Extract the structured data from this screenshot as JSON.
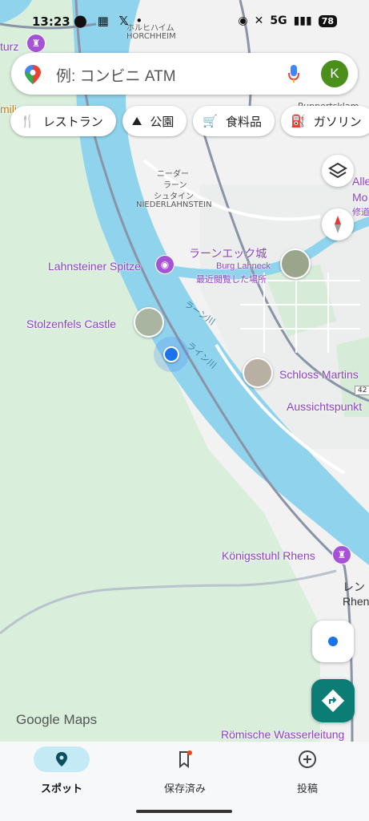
{
  "status_bar": {
    "time": "13:23",
    "network": "5G",
    "battery": "78"
  },
  "search": {
    "placeholder": "例: コンビニ ATM",
    "avatar_letter": "K"
  },
  "chips": [
    {
      "icon": "restaurant-icon",
      "label": "レストラン"
    },
    {
      "icon": "park-icon",
      "label": "公園"
    },
    {
      "icon": "grocery-icon",
      "label": "食料品"
    },
    {
      "icon": "gas-icon",
      "label": "ガソリン"
    }
  ],
  "map_labels": {
    "top_left_partial": "turz",
    "top_left_partial2": "mili",
    "horchheim_jp": "ホルヒハイム",
    "horchheim": "HORCHHEIM",
    "ruppertsklamm": "Ruppertsklam",
    "niederlahnstein_jp1": "ニーダー",
    "niederlahnstein_jp2": "ラーン",
    "niederlahnstein_jp3": "シュタイン",
    "niederlahnstein": "NIEDERLAHNSTEIN",
    "allerheiligen_partial": "Alle",
    "allerheiligen_partial2": "Mo",
    "allerheiligen_partial3": "修道",
    "lahnsteiner_spitze": "Lahnsteiner Spitze",
    "burg_lahneck_jp": "ラーンエック城",
    "burg_lahneck": "Burg Lahneck",
    "recently_viewed": "最近閲覧した場所",
    "lahn_river": "ラーン川",
    "rhine_river": "ライン川",
    "stolzenfels": "Stolzenfels Castle",
    "schloss_martinsburg": "Schloss Martins",
    "aussichtspunkt": "Aussichtspunkt",
    "route_42": "42",
    "koenigsstuhl": "Königsstuhl Rhens",
    "rhens_jp": "レン",
    "rhens": "Rhen",
    "roemische": "Römische Wasserleitung",
    "google_maps": "Google Maps"
  },
  "bottom_nav": [
    {
      "icon": "explore-pin-icon",
      "label": "スポット",
      "active": true
    },
    {
      "icon": "bookmark-icon",
      "label": "保存済み",
      "active": false
    },
    {
      "icon": "add-circle-icon",
      "label": "投稿",
      "active": false
    }
  ]
}
